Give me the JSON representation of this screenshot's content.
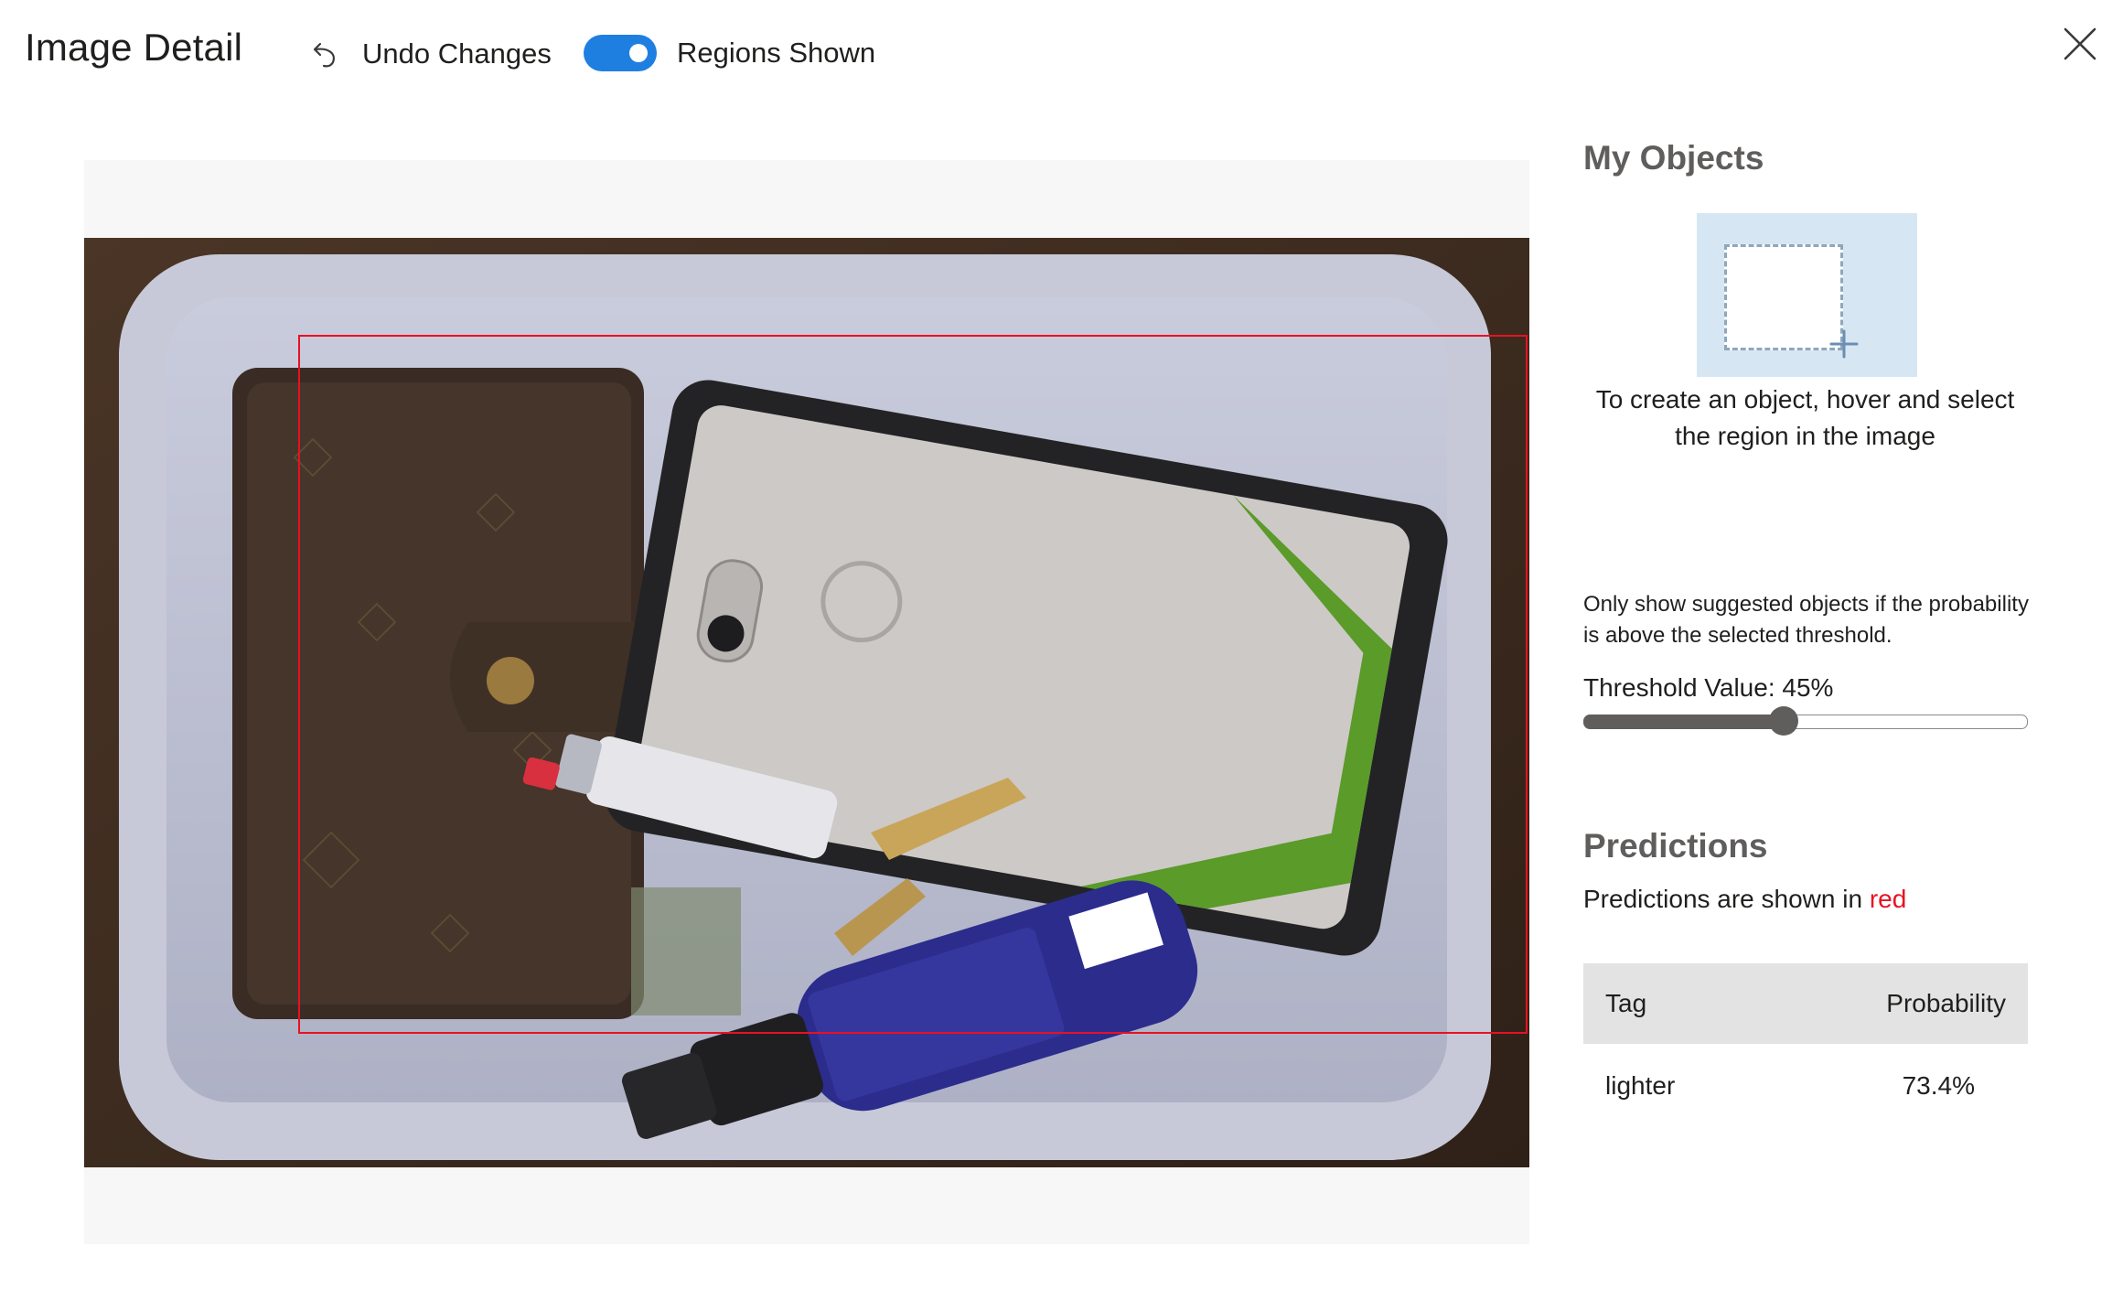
{
  "header": {
    "title": "Image Detail",
    "undo_label": "Undo Changes",
    "regions_toggle_label": "Regions Shown",
    "regions_toggle_on": true
  },
  "colors": {
    "accent": "#1e7fe0",
    "prediction": "#e81123",
    "illustration_bg": "#d6e6f3"
  },
  "icons": {
    "undo": "undo-icon",
    "close": "close-icon",
    "region_add": "region-add-icon"
  },
  "my_objects": {
    "heading": "My Objects",
    "hint": "To create an object, hover and select the region in the image"
  },
  "threshold": {
    "note": "Only show suggested objects if the probability is above the selected threshold.",
    "label": "Threshold Value: 45%",
    "value": 0.45
  },
  "predictions": {
    "heading": "Predictions",
    "note_prefix": "Predictions are shown in ",
    "note_color_word": "red",
    "columns": [
      "Tag",
      "Probability"
    ],
    "rows": [
      {
        "tag": "lighter",
        "probability": "73.4%"
      }
    ]
  }
}
